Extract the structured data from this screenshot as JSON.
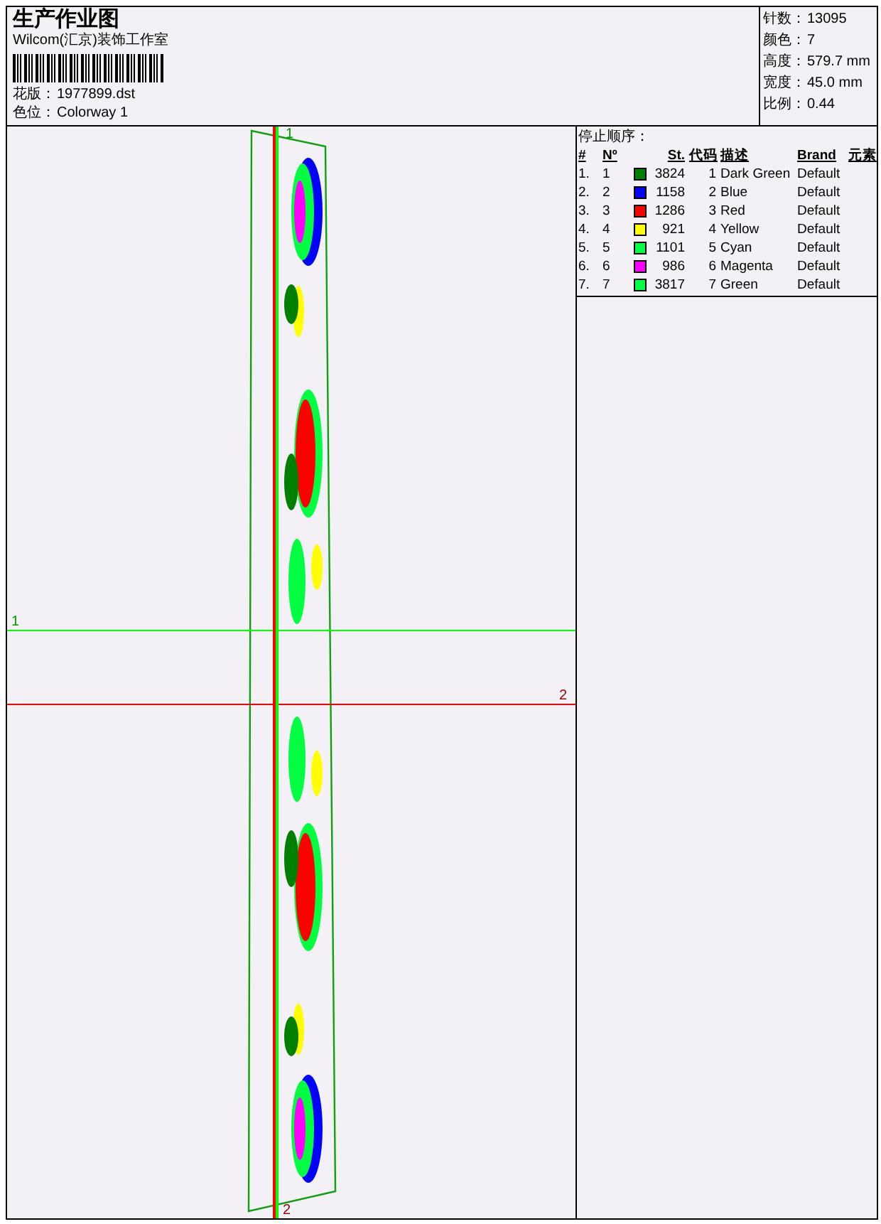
{
  "title": "生产作业图",
  "company": "Wilcom(汇京)装饰工作室",
  "design_file": {
    "label": "花版：",
    "value": "1977899.dst"
  },
  "colorway": {
    "label": "色位：",
    "value": "Colorway 1"
  },
  "stats": [
    {
      "label": "针数：",
      "value": "13095"
    },
    {
      "label": "颜色：",
      "value": "7"
    },
    {
      "label": "高度：",
      "value": "579.7 mm"
    },
    {
      "label": "宽度：",
      "value": "45.0 mm"
    },
    {
      "label": "比例：",
      "value": "0.44"
    }
  ],
  "design": {
    "horizontal_guides": [
      {
        "label": "1",
        "color": "#00ff00"
      },
      {
        "label": "2",
        "color": "#ff0000"
      }
    ],
    "vertical_guides": [
      {
        "label": "1",
        "color": "#00ff00"
      },
      {
        "label": "2",
        "color": "#ff0000"
      }
    ]
  },
  "stop_sequence": {
    "title": "停止顺序：",
    "columns": [
      "#",
      "Nº",
      "St.",
      "代码",
      "描述",
      "Brand",
      "元素"
    ],
    "rows": [
      {
        "index": "1.",
        "number": "1",
        "color": "#008000",
        "stitches": "3824",
        "code": "1",
        "description": "Dark Green",
        "brand": "Default"
      },
      {
        "index": "2.",
        "number": "2",
        "color": "#0000ff",
        "stitches": "1158",
        "code": "2",
        "description": "Blue",
        "brand": "Default"
      },
      {
        "index": "3.",
        "number": "3",
        "color": "#ff0000",
        "stitches": "1286",
        "code": "3",
        "description": "Red",
        "brand": "Default"
      },
      {
        "index": "4.",
        "number": "4",
        "color": "#ffff00",
        "stitches": "921",
        "code": "4",
        "description": "Yellow",
        "brand": "Default"
      },
      {
        "index": "5.",
        "number": "5",
        "color": "#00ff40",
        "stitches": "1101",
        "code": "5",
        "description": "Cyan",
        "brand": "Default"
      },
      {
        "index": "6.",
        "number": "6",
        "color": "#ff00ff",
        "stitches": "986",
        "code": "6",
        "description": "Magenta",
        "brand": "Default"
      },
      {
        "index": "7.",
        "number": "7",
        "color": "#00ff40",
        "stitches": "3817",
        "code": "7",
        "description": "Green",
        "brand": "Default"
      }
    ]
  }
}
